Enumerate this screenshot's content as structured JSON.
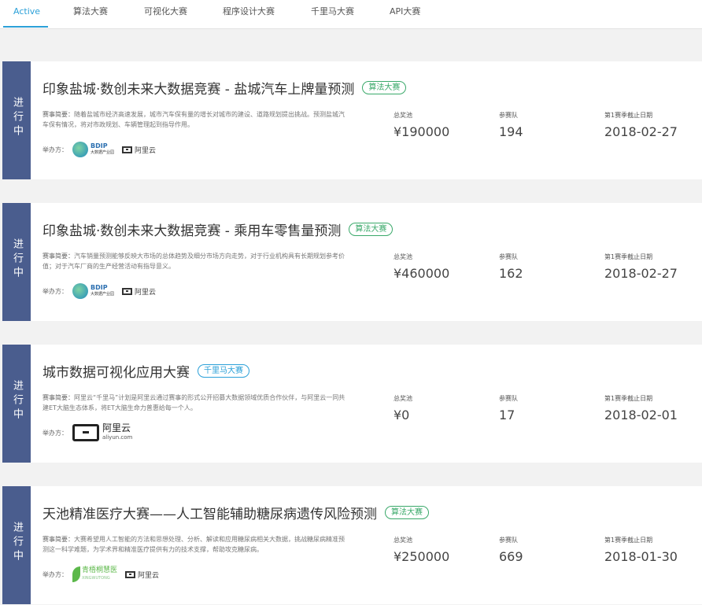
{
  "tabs": [
    "Active",
    "算法大赛",
    "可视化大赛",
    "程序设计大赛",
    "千里马大赛",
    "API大赛"
  ],
  "labels": {
    "status": "进行中",
    "desc_label": "赛事简要：",
    "organizer_label": "举办方：",
    "prize_label": "总奖池",
    "teams_label": "参赛队",
    "deadline_label": "第1赛季截止日期"
  },
  "logos": {
    "bdip_main": "BDIP",
    "bdip_sub": "大数据产业园",
    "aliyun": "阿里云",
    "aliyun_domain": "aliyun.com",
    "green_main": "青梧桐慧医",
    "green_sub": "XINGWUTONG"
  },
  "competitions": [
    {
      "title": "印象盐城·数创未来大数据竞赛 - 盐城汽车上牌量预测",
      "tag": "算法大赛",
      "description": "随着盐城市经济高速发展，城市汽车保有量的增长对城市的建设、道路规划提出挑战。预测盐城汽车保有情况，将对市政规划、车辆管理起到指导作用。",
      "prize": "¥190000",
      "teams": "194",
      "deadline": "2018-02-27"
    },
    {
      "title": "印象盐城·数创未来大数据竞赛 - 乘用车零售量预测",
      "tag": "算法大赛",
      "description": "汽车销量预测能够反映大市场的总体趋势及细分市场方向走势，对于行业机构具有长期规划参考价值；对于汽车厂商的生产经营活动有指导意义。",
      "prize": "¥460000",
      "teams": "162",
      "deadline": "2018-02-27"
    },
    {
      "title": "城市数据可视化应用大赛",
      "tag": "千里马大赛",
      "description": "阿里云“千里马”计划是阿里云通过赛事的形式公开招募大数据领域优质合作伙伴，与阿里云一同共建ET大脑生态体系，将ET大脑生命力普惠给每一个人。",
      "prize": "¥0",
      "teams": "17",
      "deadline": "2018-02-01"
    },
    {
      "title": "天池精准医疗大赛——人工智能辅助糖尿病遗传风险预测",
      "tag": "算法大赛",
      "description": "大赛希望用人工智能的方法和思想处理、分析、解读和应用糖尿病相关大数据，挑战糖尿病精准预测这一科学难题，为学术界和精准医疗提供有力的技术支撑，帮助攻克糖尿病。",
      "prize": "¥250000",
      "teams": "669",
      "deadline": "2018-01-30"
    }
  ],
  "colors": {
    "accent": "#2ba0d8",
    "status_bg": "#4a5d8e",
    "algo_tag": "#3aa96a"
  }
}
